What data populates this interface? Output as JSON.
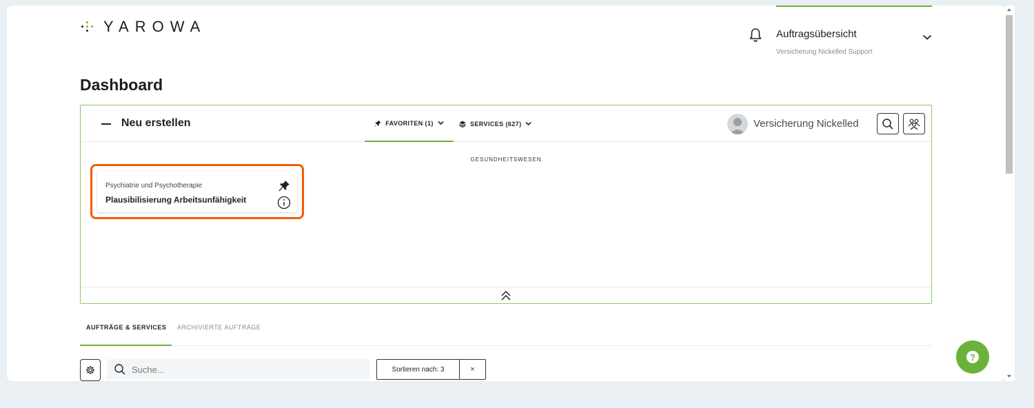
{
  "app": {
    "logo_text": "YAROWA",
    "accent_color": "#6bb23a",
    "highlight_color": "#f25c05"
  },
  "header": {
    "notifications_icon": "bell-icon",
    "order_overview_title": "Auftragsübersicht",
    "order_overview_subtitle": "Versicherung Nickelled Support"
  },
  "page": {
    "title": "Dashboard"
  },
  "create_panel": {
    "label": "Neu erstellen",
    "tabs": [
      {
        "label": "FAVORITEN (1)",
        "icon": "pin-icon",
        "active": true
      },
      {
        "label": "SERVICES (627)",
        "icon": "layers-icon",
        "active": false
      }
    ],
    "user_name": "Versicherung Nickelled",
    "section_label": "GESUNDHEITSWESEN",
    "services": [
      {
        "category": "Psychiatrie und Psychotherapie",
        "title": "Plausibilisierung Arbeitsunfähigkeit"
      }
    ]
  },
  "lower_tabs": [
    {
      "label": "AUFTRÄGE & SERVICES",
      "active": true
    },
    {
      "label": "ARCHIVIERTE AUFTRÄGE",
      "active": false
    }
  ],
  "toolbar": {
    "search_placeholder": "Suche...",
    "sort_label": "Sortieren nach: 3",
    "sort_clear": "×"
  },
  "help": {
    "label": "?"
  }
}
